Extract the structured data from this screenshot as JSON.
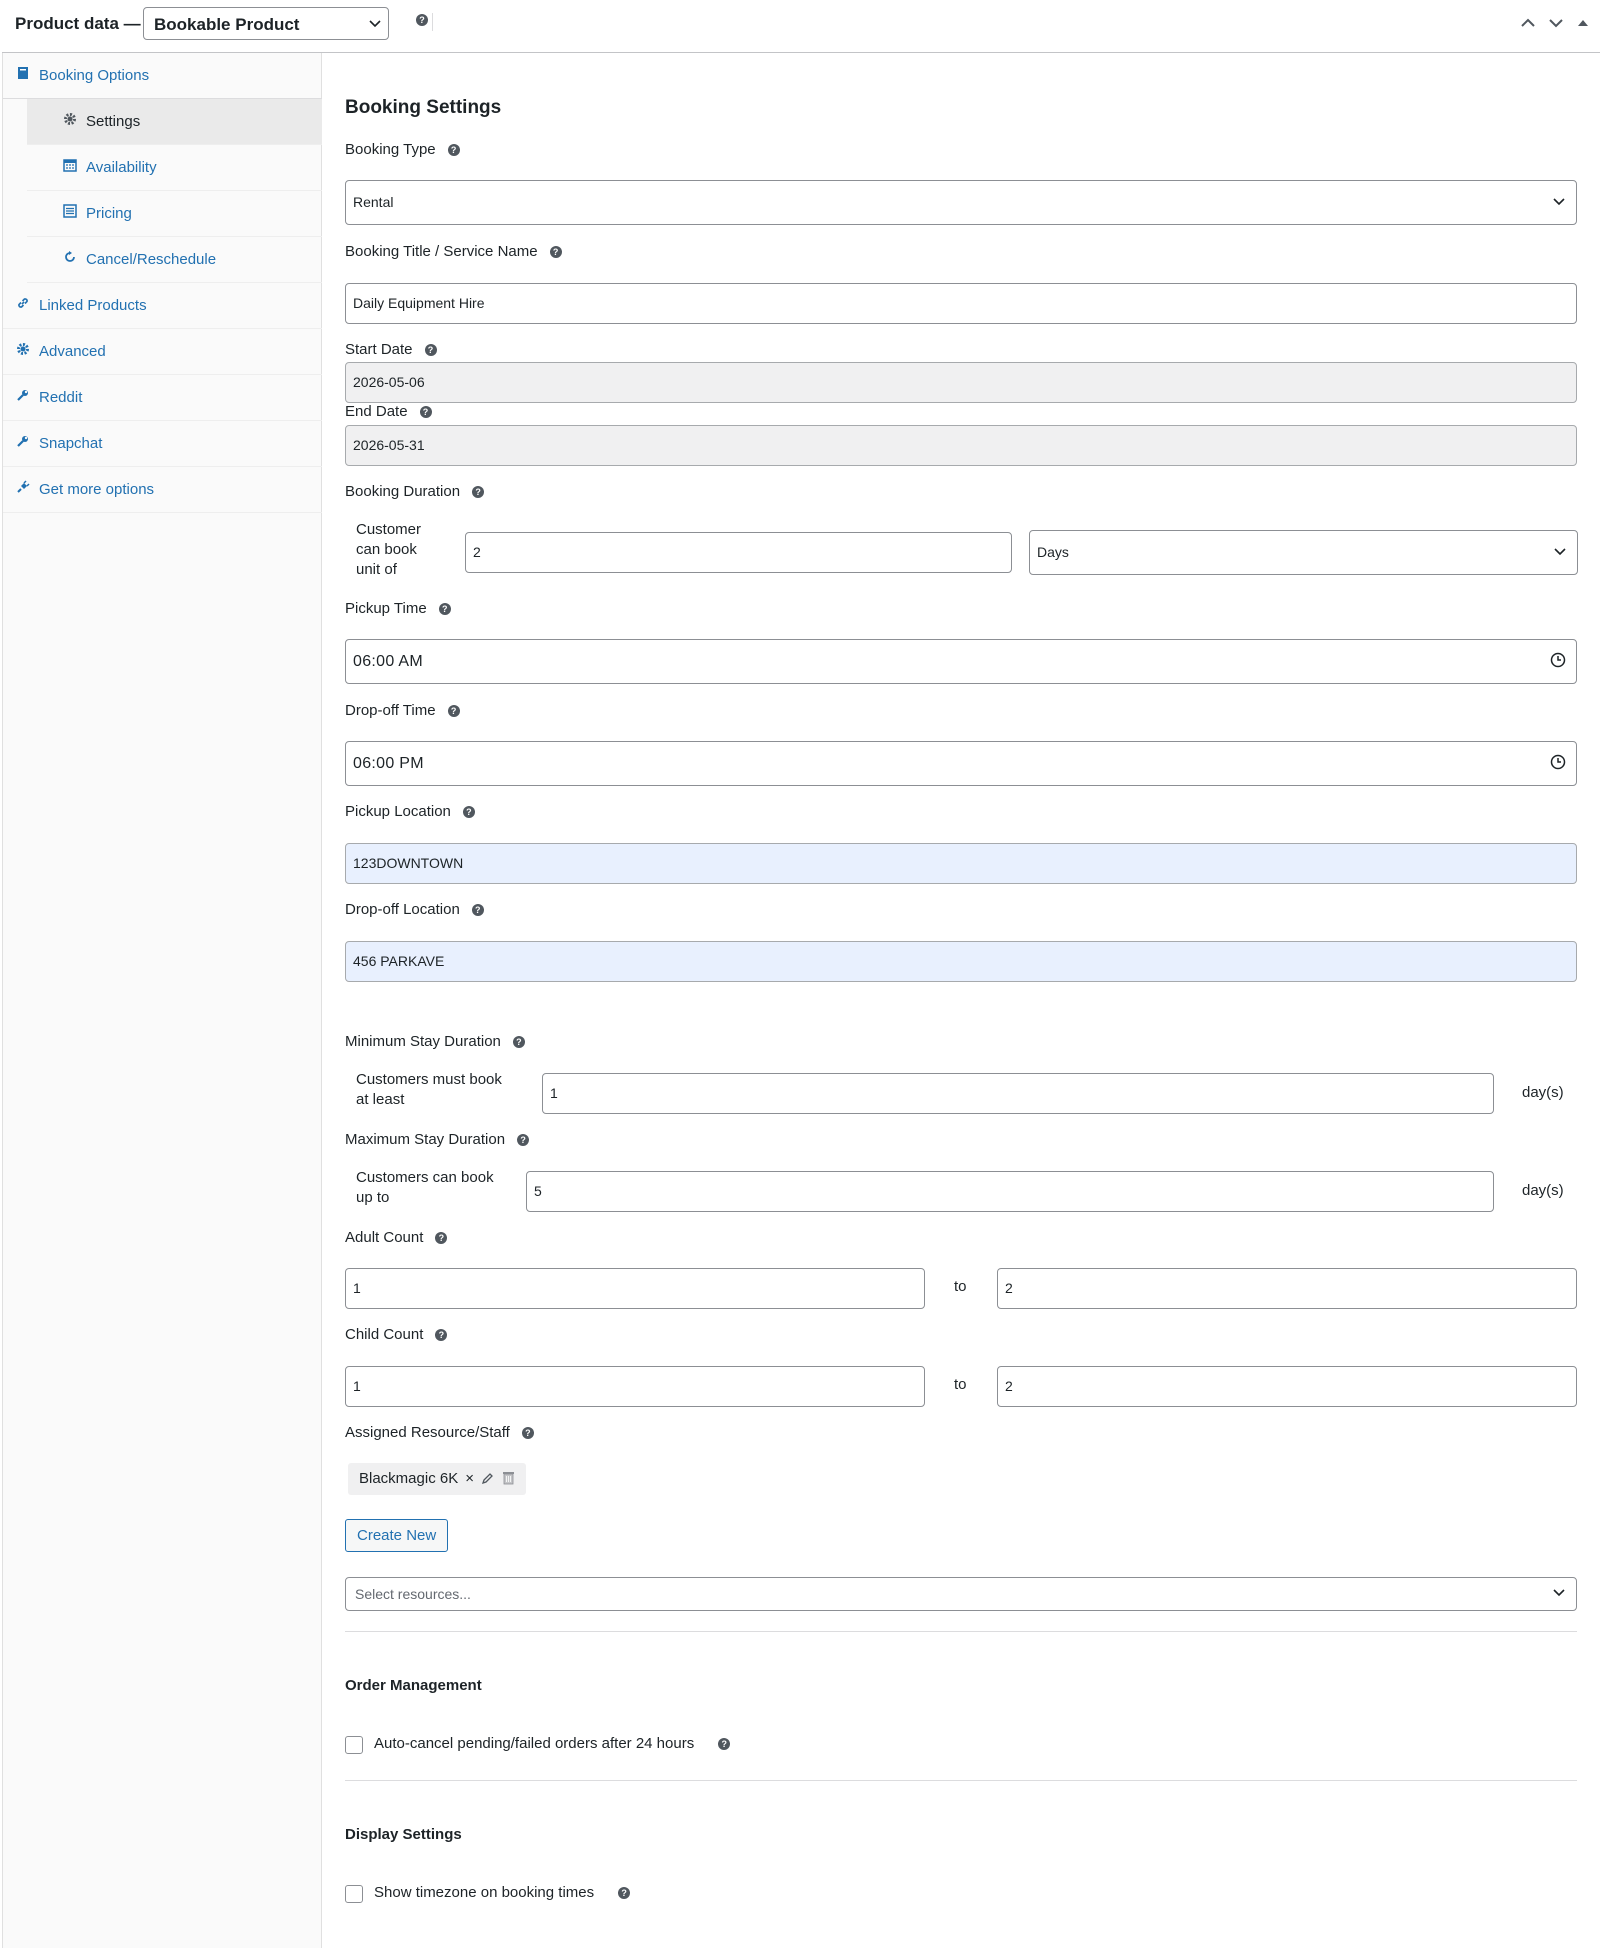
{
  "header": {
    "title": "Product data —",
    "product_type": "Bookable Product",
    "help": "?"
  },
  "sidebar": {
    "items": [
      {
        "label": "Booking Options",
        "icon": "book-icon"
      },
      {
        "label": "Settings",
        "icon": "gear-icon"
      },
      {
        "label": "Availability",
        "icon": "calendar-icon"
      },
      {
        "label": "Pricing",
        "icon": "list-icon"
      },
      {
        "label": "Cancel/Reschedule",
        "icon": "refresh-icon"
      },
      {
        "label": "Linked Products",
        "icon": "link-icon"
      },
      {
        "label": "Advanced",
        "icon": "gear-icon"
      },
      {
        "label": "Reddit",
        "icon": "wrench-icon"
      },
      {
        "label": "Snapchat",
        "icon": "wrench-icon"
      },
      {
        "label": "Get more options",
        "icon": "plugin-icon"
      }
    ]
  },
  "main": {
    "section_title": "Booking Settings",
    "booking_type": {
      "label": "Booking Type",
      "value": "Rental"
    },
    "booking_title": {
      "label": "Booking Title / Service Name",
      "value": "Daily Equipment Hire"
    },
    "start_date": {
      "label": "Start Date",
      "value": "2026-05-06"
    },
    "end_date": {
      "label": "End Date",
      "value": "2026-05-31"
    },
    "booking_duration": {
      "label": "Booking Duration",
      "sub_label_1": "Customer",
      "sub_label_2": "can book",
      "sub_label_3": "unit of",
      "value": "2",
      "unit": "Days"
    },
    "pickup_time": {
      "label": "Pickup Time",
      "value": "06:00 AM"
    },
    "dropoff_time": {
      "label": "Drop-off Time",
      "value": "06:00 PM"
    },
    "pickup_location": {
      "label": "Pickup Location",
      "value": "123DOWNTOWN"
    },
    "dropoff_location": {
      "label": "Drop-off Location",
      "value": "456 PARKAVE"
    },
    "min_stay": {
      "label": "Minimum Stay Duration",
      "sub_label_1": "Customers must book",
      "sub_label_2": "at least",
      "value": "1",
      "unit": "day(s)"
    },
    "max_stay": {
      "label": "Maximum Stay Duration",
      "sub_label_1": "Customers can book",
      "sub_label_2": "up to",
      "value": "5",
      "unit": "day(s)"
    },
    "adult_count": {
      "label": "Adult Count",
      "min": "1",
      "to": "to",
      "max": "2"
    },
    "child_count": {
      "label": "Child Count",
      "min": "1",
      "to": "to",
      "max": "2"
    },
    "resources": {
      "label": "Assigned Resource/Staff",
      "chip": "Blackmagic 6K",
      "chip_remove": "×",
      "create_button": "Create New",
      "select_placeholder": "Select resources..."
    },
    "order_management": {
      "title": "Order Management",
      "auto_cancel_label": "Auto-cancel pending/failed orders after 24 hours",
      "auto_cancel_checked": false
    },
    "display_settings": {
      "title": "Display Settings",
      "timezone_label": "Show timezone on booking times",
      "timezone_checked": false
    }
  }
}
